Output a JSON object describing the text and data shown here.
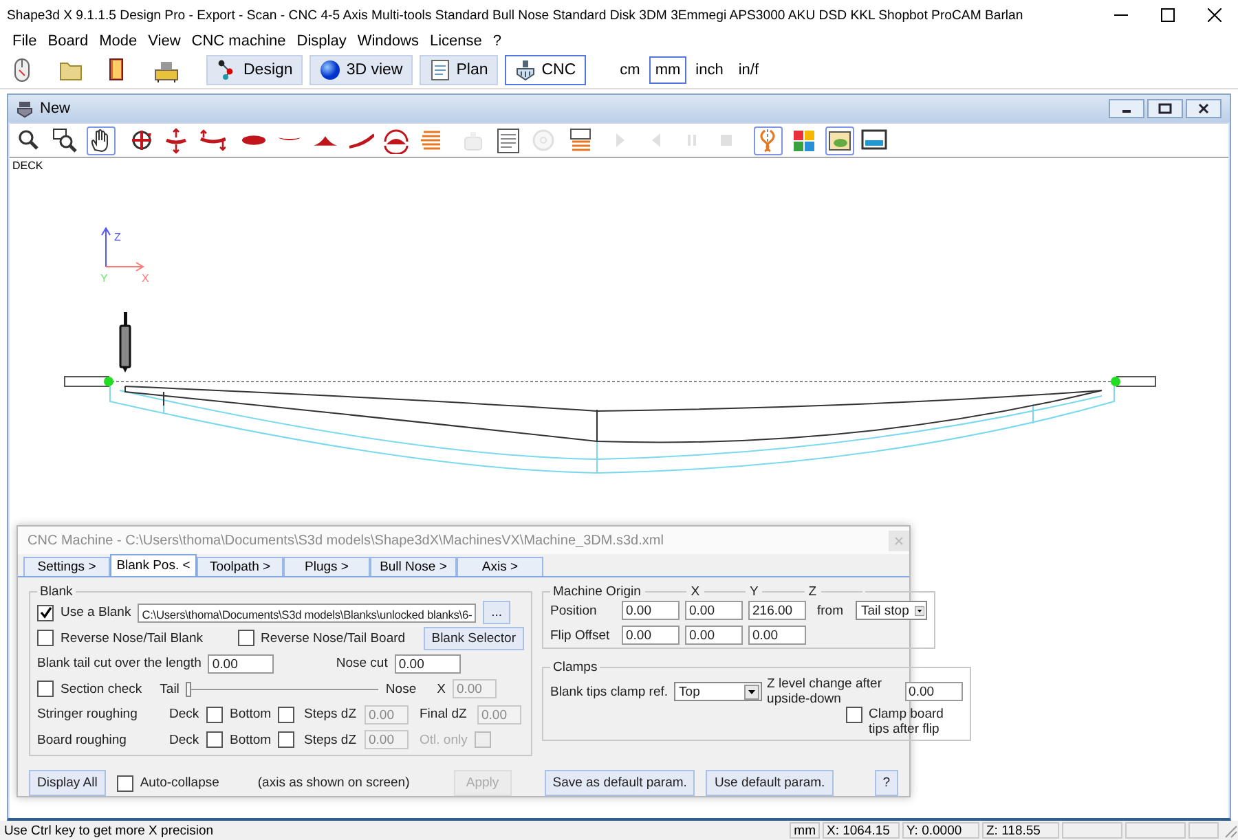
{
  "window": {
    "title": "Shape3d X 9.1.1.5 Design Pro - Export - Scan - CNC 4-5 Axis Multi-tools  Standard Bull Nose Standard Disk 3DM 3Emmegi APS3000 AKU DSD KKL Shopbot ProCAM Barlan"
  },
  "menu": [
    "File",
    "Board",
    "Mode",
    "View",
    "CNC machine",
    "Display",
    "Windows",
    "License",
    "?"
  ],
  "modes": [
    {
      "kind": "design",
      "label": "Design",
      "selected": false
    },
    {
      "kind": "view3d",
      "label": "3D view",
      "selected": false
    },
    {
      "kind": "plan",
      "label": "Plan",
      "selected": false
    },
    {
      "kind": "cnc",
      "label": "CNC",
      "selected": true
    }
  ],
  "units": [
    {
      "label": "cm",
      "selected": false
    },
    {
      "label": "mm",
      "selected": true
    },
    {
      "label": "inch",
      "selected": false
    },
    {
      "label": "in/f",
      "selected": false
    }
  ],
  "document": {
    "title": "New",
    "tools": [
      {
        "kind": "zoom",
        "selected": false,
        "disabled": false
      },
      {
        "kind": "zoom-box",
        "selected": false,
        "disabled": false
      },
      {
        "kind": "pan",
        "selected": true,
        "disabled": false
      },
      {
        "kind": "rotate",
        "selected": false,
        "disabled": false
      },
      {
        "kind": "move-vertical",
        "selected": false,
        "disabled": false
      },
      {
        "kind": "rocker",
        "selected": false,
        "disabled": false
      },
      {
        "kind": "outline",
        "selected": false,
        "disabled": false
      },
      {
        "kind": "rail",
        "selected": false,
        "disabled": false
      },
      {
        "kind": "slice",
        "selected": false,
        "disabled": false
      },
      {
        "kind": "profile",
        "selected": false,
        "disabled": false
      },
      {
        "kind": "spin",
        "selected": false,
        "disabled": false
      },
      {
        "kind": "layers",
        "selected": false,
        "disabled": false
      },
      {
        "kind": "camera",
        "selected": false,
        "disabled": true
      },
      {
        "kind": "sheet",
        "selected": false,
        "disabled": false
      },
      {
        "kind": "disc",
        "selected": false,
        "disabled": true
      },
      {
        "kind": "stack",
        "selected": false,
        "disabled": false
      },
      {
        "kind": "play",
        "selected": false,
        "disabled": true
      },
      {
        "kind": "back",
        "selected": false,
        "disabled": true
      },
      {
        "kind": "pause",
        "selected": false,
        "disabled": true
      },
      {
        "kind": "stop",
        "selected": false,
        "disabled": true
      },
      {
        "kind": "mirror",
        "selected": true,
        "disabled": false
      },
      {
        "kind": "colors",
        "selected": false,
        "disabled": false
      },
      {
        "kind": "image",
        "selected": true,
        "disabled": false
      },
      {
        "kind": "screen",
        "selected": false,
        "disabled": false
      }
    ],
    "view_label": "DECK",
    "axes": {
      "z": "Z",
      "y": "Y",
      "x": "X"
    }
  },
  "dialog": {
    "title": "CNC Machine - C:\\Users\\thoma\\Documents\\S3d models\\Shape3dX\\MachinesVX\\Machine_3DM.s3d.xml",
    "tabs": [
      {
        "label": "Settings >",
        "selected": false
      },
      {
        "label": "Blank Pos. <",
        "selected": true
      },
      {
        "label": "Toolpath >",
        "selected": false
      },
      {
        "label": "Plugs >",
        "selected": false
      },
      {
        "label": "Bull Nose >",
        "selected": false
      },
      {
        "label": "Axis >",
        "selected": false
      }
    ],
    "blank": {
      "title": "Blank",
      "use_blank": {
        "label": "Use a Blank",
        "checked": true
      },
      "blank_file": {
        "value": "C:\\Users\\thoma\\Documents\\S3d models\\Blanks\\unlocked blanks\\6-"
      },
      "browse_button": {
        "label": "..."
      },
      "reverse_blank": {
        "label": "Reverse Nose/Tail Blank",
        "checked": false
      },
      "reverse_board": {
        "label": "Reverse Nose/Tail Board",
        "checked": false
      },
      "selector_button": {
        "label": "Blank Selector"
      },
      "tail_cut": {
        "label": "Blank tail cut over the length",
        "value": "0.00"
      },
      "nose_cut": {
        "label": "Nose cut",
        "value": "0.00"
      },
      "section_check": {
        "label": "Section check",
        "checked": false
      },
      "section_slider": {
        "start_label": "Tail",
        "end_label": "Nose",
        "level": 0
      },
      "section_x": {
        "label": "X",
        "value": "0.00",
        "disabled": true
      },
      "stringer_roughing": {
        "label": "Stringer roughing",
        "deck": {
          "label": "Deck",
          "checked": false
        },
        "bottom": {
          "label": "Bottom",
          "checked": false
        },
        "steps": {
          "label": "Steps dZ",
          "value": "0.00",
          "disabled": true
        },
        "final": {
          "label": "Final dZ",
          "value": "0.00",
          "disabled": true
        }
      },
      "board_roughing": {
        "label": "Board roughing",
        "deck": {
          "label": "Deck",
          "checked": false
        },
        "bottom": {
          "label": "Bottom",
          "checked": false
        },
        "steps": {
          "label": "Steps dZ",
          "value": "0.00",
          "disabled": true
        },
        "outline_only": {
          "label": "Otl. only",
          "checked": false,
          "disabled": true
        }
      }
    },
    "origin": {
      "title": "Machine Origin",
      "columns": [
        "X",
        "Y",
        "Z"
      ],
      "position": {
        "label": "Position",
        "values": [
          "0.00",
          "0.00",
          "216.00"
        ],
        "from_label": "from",
        "from": "Tail stop"
      },
      "flip_offset": {
        "label": "Flip Offset",
        "values": [
          "0.00",
          "0.00",
          "0.00"
        ]
      }
    },
    "clamps": {
      "title": "Clamps",
      "clamp_ref": {
        "label": "Blank tips clamp ref.",
        "value": "Top"
      },
      "z_change": {
        "label": "Z level change after upside-down",
        "value": "0.00"
      },
      "clamp_tips": {
        "label": "Clamp board tips after flip",
        "checked": false
      }
    },
    "footer": {
      "display_all": {
        "label": "Display All"
      },
      "auto_collapse": {
        "label": "Auto-collapse",
        "checked": false
      },
      "note": "(axis as shown on screen)",
      "apply": {
        "label": "Apply",
        "disabled": true
      },
      "save_default": {
        "label": "Save as default param."
      },
      "use_default": {
        "label": "Use default param."
      },
      "help": {
        "label": "?"
      }
    }
  },
  "status_bar": {
    "message": "Use Ctrl key to get more X precision",
    "unit": "mm",
    "x": "X: 1064.15",
    "y": "Y: 0.0000",
    "z": "Z: 118.55"
  }
}
